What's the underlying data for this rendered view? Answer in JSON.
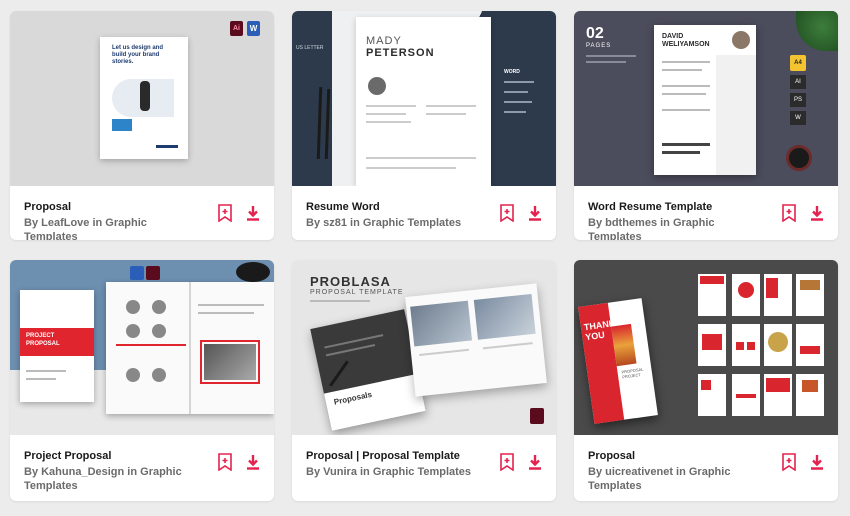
{
  "accent": "#e3234e",
  "cards": [
    {
      "title": "Proposal",
      "byline": "By LeafLove in Graphic Templates",
      "thumb": {
        "cover_text": "Let us design and build your brand stories.",
        "badge1": "Ai",
        "badge2": "W"
      }
    },
    {
      "title": "Resume Word",
      "byline": "By sz81 in Graphic Templates",
      "thumb": {
        "name_first": "MADY",
        "name_last": "PETERSON",
        "side_label": "WORD",
        "size_label": "US LETTER"
      }
    },
    {
      "title": "Word Resume Template",
      "byline": "By bdthemes in Graphic Templates",
      "thumb": {
        "pages_num": "02",
        "pages_label": "PAGES",
        "name_first": "DAVID",
        "name_last": "WELIYAMSON",
        "size_badge": "A4",
        "formats": [
          "AI",
          "PS",
          "W"
        ]
      }
    },
    {
      "title": "Project Proposal",
      "byline": "By Kahuna_Design in Graphic Templates",
      "thumb": {
        "cover_title": "PROJECT PROPOSAL"
      }
    },
    {
      "title": "Proposal | Proposal Template",
      "byline": "By Vunira in Graphic Templates",
      "thumb": {
        "heading": "PROBLASA",
        "subheading": "PROPOSAL TEMPLATE",
        "brochure_label": "Proposals"
      }
    },
    {
      "title": "Proposal",
      "byline": "By uicreativenet in Graphic Templates",
      "thumb": {
        "cover_big": "THANK YOU",
        "cover_small": "PROPOSAL PROJECT"
      }
    }
  ]
}
